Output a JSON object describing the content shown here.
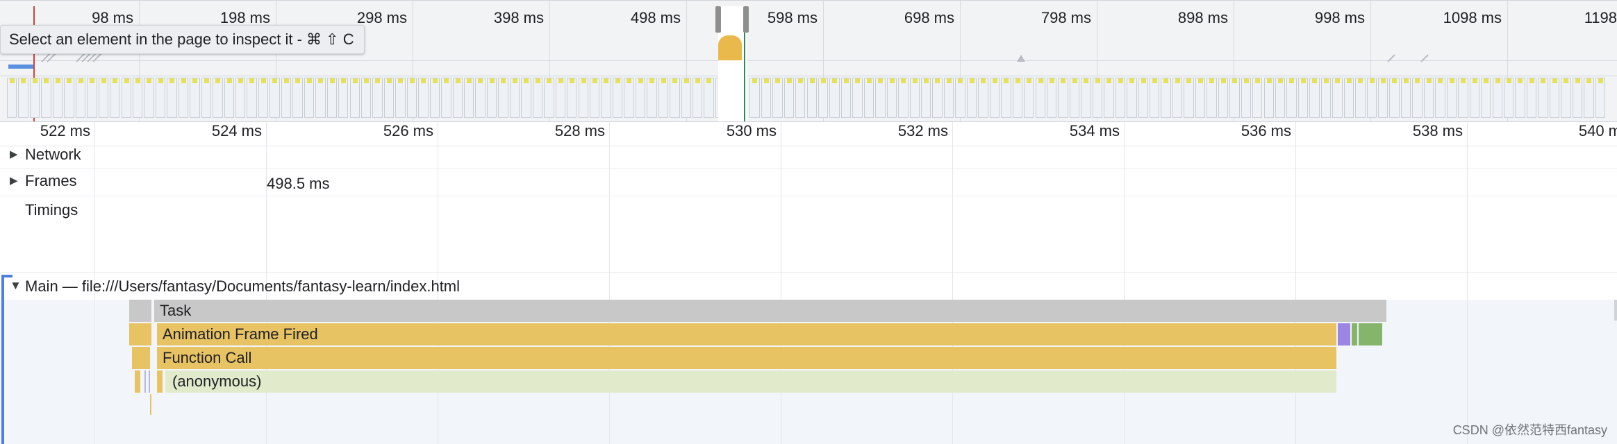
{
  "overview": {
    "ticks": [
      "98 ms",
      "198 ms",
      "298 ms",
      "398 ms",
      "498 ms",
      "598 ms",
      "698 ms",
      "798 ms",
      "898 ms",
      "998 ms",
      "1098 ms",
      "1198"
    ],
    "tooltip": "Select an element in the page to inspect it - ⌘ ⇧ C"
  },
  "ruler": {
    "ticks": [
      "522 ms",
      "524 ms",
      "526 ms",
      "528 ms",
      "530 ms",
      "532 ms",
      "534 ms",
      "536 ms",
      "538 ms",
      "540 m"
    ]
  },
  "tracks": {
    "network": "Network",
    "frames": "Frames",
    "frames_value": "498.5 ms",
    "timings": "Timings"
  },
  "main": {
    "title": "Main — file:///Users/fantasy/Documents/fantasy-learn/index.html",
    "task": "Task",
    "animation_frame": "Animation Frame Fired",
    "function_call": "Function Call",
    "anonymous": "(anonymous)"
  },
  "colors": {
    "task": "#c8c8c8",
    "scripting": "#e8c364",
    "anonymous": "#e1ebcb",
    "rendering": "#9b86e6",
    "painting": "#84b56b",
    "bracket": "#4e7ee0"
  },
  "watermark": "CSDN @依然范特西fantasy"
}
